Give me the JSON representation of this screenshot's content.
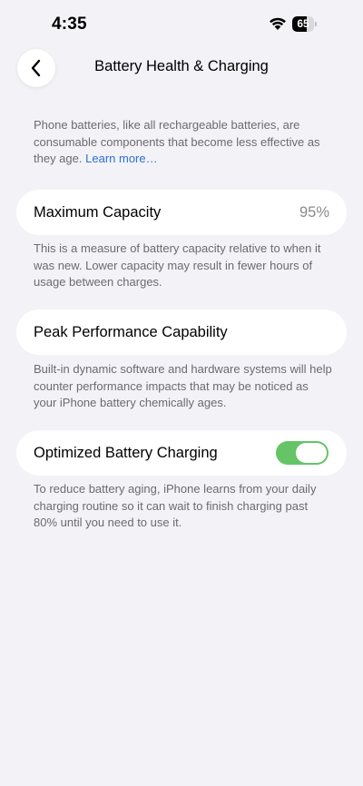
{
  "status_bar": {
    "time": "4:35",
    "battery_level": "65",
    "battery_fraction": 0.65
  },
  "nav": {
    "title": "Battery Health & Charging"
  },
  "intro": {
    "text": "Phone batteries, like all rechargeable batteries, are consumable components that become less effective as they age.",
    "link": "Learn more…"
  },
  "max_capacity": {
    "label": "Maximum Capacity",
    "value": "95%",
    "footer": "This is a measure of battery capacity relative to when it was new. Lower capacity may result in fewer hours of usage between charges."
  },
  "peak_performance": {
    "label": "Peak Performance Capability",
    "footer": "Built-in dynamic software and hardware systems will help counter performance impacts that may be noticed as your iPhone battery chemically ages."
  },
  "optimized_charging": {
    "label": "Optimized Battery Charging",
    "enabled": true,
    "toggle_color": "#65c466",
    "footer": "To reduce battery aging, iPhone learns from your daily charging routine so it can wait to finish charging past 80% until you need to use it."
  },
  "colors": {
    "link": "#2f6fd6",
    "background": "#f2f2f7"
  },
  "icons": {
    "back": "chevron-left-icon",
    "wifi": "wifi-icon",
    "battery": "battery-icon"
  }
}
